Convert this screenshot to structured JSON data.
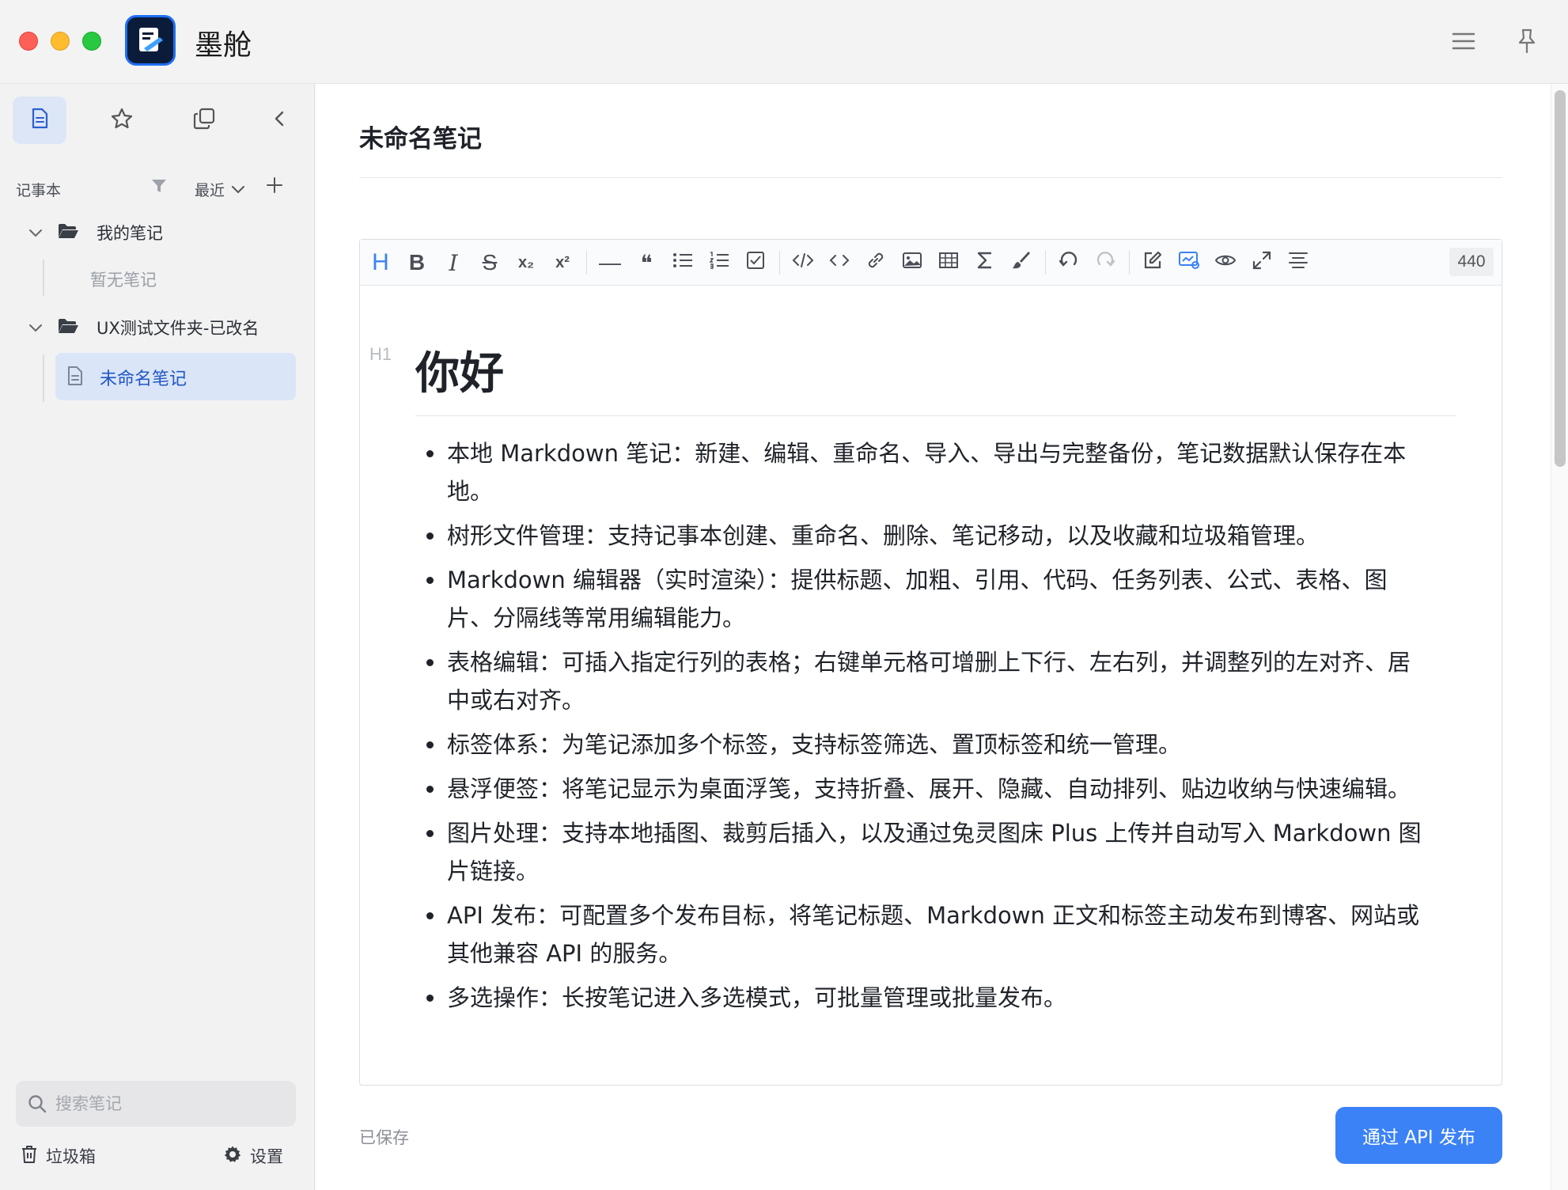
{
  "app": {
    "name": "墨舱"
  },
  "sidebar": {
    "header_label": "记事本",
    "sort_label": "最近",
    "tree": [
      {
        "label": "我的笔记",
        "empty": "暂无笔记"
      },
      {
        "label": "UX测试文件夹-已改名",
        "note": "未命名笔记"
      }
    ],
    "search_placeholder": "搜索笔记",
    "trash_label": "垃圾箱",
    "settings_label": "设置"
  },
  "note": {
    "title": "未命名笔记",
    "word_count": "440",
    "h1_marker": "H1",
    "heading": "你好",
    "bullets": [
      "本地 Markdown 笔记：新建、编辑、重命名、导入、导出与完整备份，笔记数据默认保存在本地。",
      "树形文件管理：支持记事本创建、重命名、删除、笔记移动，以及收藏和垃圾箱管理。",
      "Markdown 编辑器（实时渲染）：提供标题、加粗、引用、代码、任务列表、公式、表格、图片、分隔线等常用编辑能力。",
      "表格编辑：可插入指定行列的表格；右键单元格可增删上下行、左右列，并调整列的左对齐、居中或右对齐。",
      "标签体系：为笔记添加多个标签，支持标签筛选、置顶标签和统一管理。",
      "悬浮便签：将笔记显示为桌面浮笺，支持折叠、展开、隐藏、自动排列、贴边收纳与快速编辑。",
      "图片处理：支持本地插图、裁剪后插入，以及通过兔灵图床 Plus 上传并自动写入 Markdown 图片链接。",
      "API 发布：可配置多个发布目标，将笔记标题、Markdown 正文和标签主动发布到博客、网站或其他兼容 API 的服务。",
      "多选操作：长按笔记进入多选模式，可批量管理或批量发布。"
    ],
    "status": "已保存",
    "publish_label": "通过 API 发布"
  },
  "toolbar": {
    "heading": "H",
    "bold": "B",
    "italic": "I",
    "strike": "S",
    "sub": "x₂",
    "sup": "x²",
    "hr": "—",
    "quote": "❝"
  },
  "colors": {
    "accent": "#3b82f6",
    "active_bg": "#dbe5f8",
    "active_text": "#1f57c5"
  }
}
